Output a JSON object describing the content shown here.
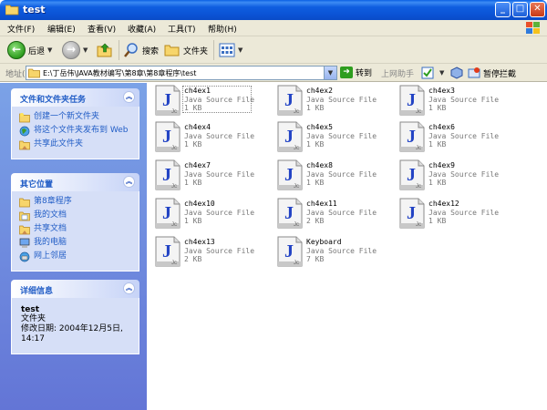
{
  "window": {
    "title": "test"
  },
  "menu": [
    "文件(F)",
    "编辑(E)",
    "查看(V)",
    "收藏(A)",
    "工具(T)",
    "帮助(H)"
  ],
  "toolbar": {
    "back": "后退",
    "search": "搜索",
    "folders": "文件夹"
  },
  "address": {
    "label": "地址(D)",
    "path": "E:\\丁岳伟\\JAVA教材编写\\第8章\\第8章程序\\test",
    "go": "转到",
    "links": "上网助手",
    "stop": "暂停拦截"
  },
  "tasks_panel": {
    "title": "文件和文件夹任务",
    "items": [
      "创建一个新文件夹",
      "将这个文件夹发布到 Web",
      "共享此文件夹"
    ]
  },
  "places_panel": {
    "title": "其它位置",
    "items": [
      "第8章程序",
      "我的文档",
      "共享文档",
      "我的电脑",
      "网上邻居"
    ]
  },
  "details_panel": {
    "title": "详细信息",
    "name": "test",
    "type": "文件夹",
    "modified": "修改日期: 2004年12月5日, 14:17"
  },
  "files": [
    {
      "name": "ch4ex1",
      "type": "Java Source File",
      "size": "1 KB",
      "selected": true
    },
    {
      "name": "ch4ex2",
      "type": "Java Source File",
      "size": "1 KB"
    },
    {
      "name": "ch4ex3",
      "type": "Java Source File",
      "size": "1 KB"
    },
    {
      "name": "ch4ex4",
      "type": "Java Source File",
      "size": "1 KB"
    },
    {
      "name": "ch4ex5",
      "type": "Java Source File",
      "size": "1 KB"
    },
    {
      "name": "ch4ex6",
      "type": "Java Source File",
      "size": "1 KB"
    },
    {
      "name": "ch4ex7",
      "type": "Java Source File",
      "size": "1 KB"
    },
    {
      "name": "ch4ex8",
      "type": "Java Source File",
      "size": "1 KB"
    },
    {
      "name": "ch4ex9",
      "type": "Java Source File",
      "size": "1 KB"
    },
    {
      "name": "ch4ex10",
      "type": "Java Source File",
      "size": "1 KB"
    },
    {
      "name": "ch4ex11",
      "type": "Java Source File",
      "size": "2 KB"
    },
    {
      "name": "ch4ex12",
      "type": "Java Source File",
      "size": "1 KB"
    },
    {
      "name": "ch4ex13",
      "type": "Java Source File",
      "size": "2 KB"
    },
    {
      "name": "Keyboard",
      "type": "Java Source File",
      "size": "7 KB"
    }
  ],
  "colors": {
    "titlebar": "#0b54d6",
    "panel_bg": "#d6dff7",
    "link": "#215dc6",
    "pane_gradient_top": "#7ba2e7",
    "pane_gradient_bottom": "#6375d6"
  }
}
